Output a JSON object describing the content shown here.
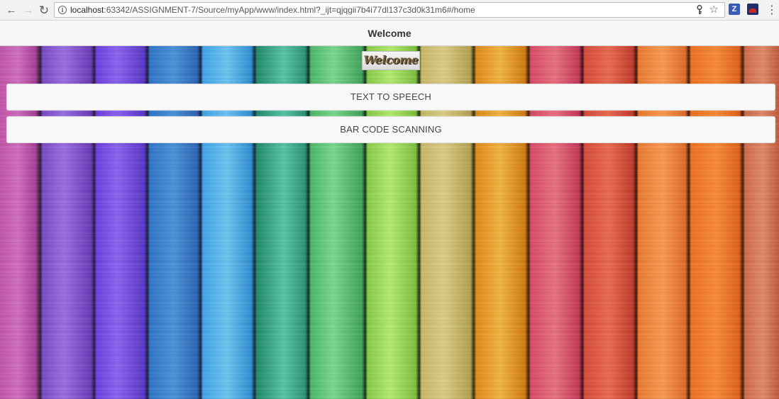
{
  "browser": {
    "url_host": "localhost",
    "url_rest": ":63342/ASSIGNMENT-7/Source/myApp/www/index.html?_ijt=qjqgii7b4i77dl137c3d0k31m6#/home",
    "back_glyph": "←",
    "forward_glyph": "→",
    "reload_glyph": "↻",
    "menu_glyph": "⋮",
    "icons": [
      "arrow-left-icon",
      "arrow-right-icon",
      "reload-icon",
      "info-icon",
      "key-icon",
      "star-icon",
      "zotero-extension-icon",
      "extension-icon",
      "kebab-menu-icon"
    ]
  },
  "header": {
    "title": "Welcome"
  },
  "main": {
    "welcome_image_text": "Welcome",
    "buttons": [
      {
        "label": "TEXT TO SPEECH"
      },
      {
        "label": "BAR CODE SCANNING"
      }
    ]
  },
  "colors": {
    "header_bg": "#f7f7f7",
    "button_bg": "#f8f8f8",
    "button_text": "#444444"
  }
}
